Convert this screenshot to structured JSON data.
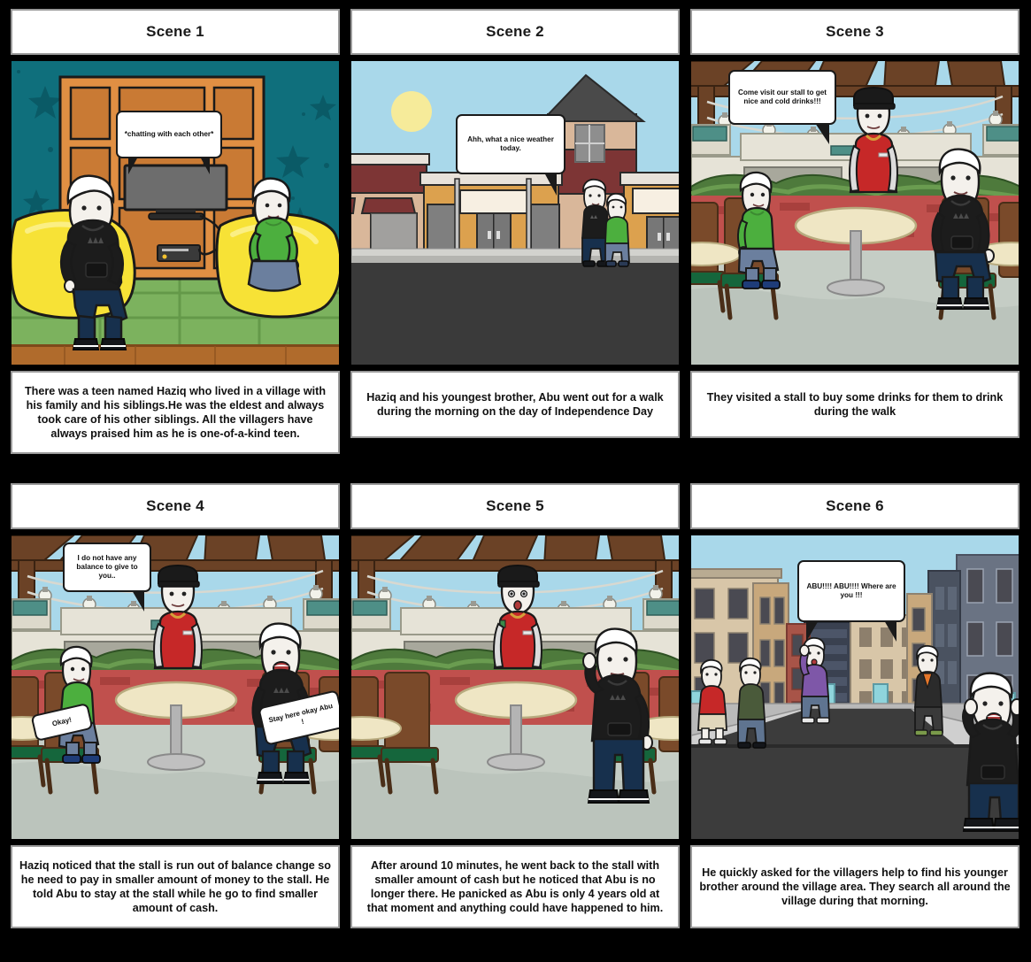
{
  "document": {
    "type": "storyboard",
    "title": "Haziq and Abu storyboard",
    "rows": 2,
    "columns": 3,
    "background_color": "#000000",
    "panel_border_color": "#9a9a9a"
  },
  "scenes": [
    {
      "id": "scene-1",
      "title": "Scene 1",
      "setting": "living-room",
      "caption": "There was a teen named Haziq who lived in a village with his family and his siblings.He was the eldest and always took care of his other siblings. All the villagers have always praised him as he is one-of-a-kind teen.",
      "bubbles": [
        {
          "text": "*chatting with each other*",
          "speaker": "narration",
          "tail": "both"
        }
      ],
      "colors": {
        "wall": "#0f6f7c",
        "shelf": "#e08f43",
        "shelf_inner": "#c97a34",
        "beanbag": "#f7e236",
        "rug": "#6aa84f",
        "floor": "#b06b2c",
        "tv_screen": "#7a7a7a"
      },
      "characters": [
        {
          "name": "Haziq",
          "shirt": "#1c1c1c",
          "pants": "#17304d",
          "pose": "sitting-beanbag-left"
        },
        {
          "name": "Abu",
          "shirt": "#4caf3e",
          "pants": "#6b7f9e",
          "pose": "kneeling-beanbag-right"
        }
      ]
    },
    {
      "id": "scene-2",
      "title": "Scene 2",
      "setting": "town-street",
      "caption": "Haziq and his youngest brother, Abu went out for a walk during the morning on the day of Independence Day",
      "bubbles": [
        {
          "text": "Ahh, what a nice weather today.",
          "speaker": "Haziq",
          "tail": "right"
        }
      ],
      "colors": {
        "sky": "#a9d8ea",
        "sun": "#f6eb9a",
        "road": "#3a3a3a",
        "sidewalk": "#c9c9c4",
        "building_tan": "#d9b79a",
        "building_orange": "#dca14e",
        "awning": "#7d3535",
        "roof": "#4a4a4a"
      },
      "characters": [
        {
          "name": "Haziq",
          "shirt": "#1c1c1c",
          "pants": "#17304d",
          "pose": "standing"
        },
        {
          "name": "Abu",
          "shirt": "#4caf3e",
          "pants": "#6b7f9e",
          "pose": "standing"
        }
      ]
    },
    {
      "id": "scene-3",
      "title": "Scene 3",
      "setting": "cafe-patio",
      "caption": "They visited a stall to buy some drinks for them to drink during the walk",
      "bubbles": [
        {
          "text": "Come visit our stall to get nice and cold drinks!!!",
          "speaker": "Stall vendor",
          "tail": "right"
        }
      ],
      "colors": {
        "sky": "#a9d8ea",
        "pergola": "#5b3a22",
        "brick_wall": "#c0504d",
        "hedge": "#4e7a3c",
        "ground": "#c5cdc5",
        "table": "#efe6c4",
        "chair_wood": "#7a4a2a",
        "chair_cushion": "#15663c",
        "vendor_shirt": "#c62828",
        "vendor_cap": "#1a1a1a"
      },
      "characters": [
        {
          "name": "Abu",
          "shirt": "#4caf3e",
          "pants": "#6b7f9e",
          "pose": "sitting-chair-left"
        },
        {
          "name": "Vendor",
          "shirt": "#c62828",
          "pants": "#d9d9d9",
          "pose": "standing-behind-counter"
        },
        {
          "name": "Haziq",
          "shirt": "#1c1c1c",
          "pants": "#17304d",
          "pose": "sitting-chair-right"
        }
      ]
    },
    {
      "id": "scene-4",
      "title": "Scene 4",
      "setting": "cafe-patio",
      "caption": "Haziq noticed that the stall is run out of balance change so he need to pay in smaller amount of money to the stall. He told Abu to stay at the stall while he go to find smaller amount of cash.",
      "bubbles": [
        {
          "text": "I do not have any balance to give to you..",
          "speaker": "Vendor",
          "tail": "right"
        },
        {
          "text": "Okay!",
          "speaker": "Abu",
          "tail": "none",
          "rotated": true
        },
        {
          "text": "Stay here okay Abu !",
          "speaker": "Haziq",
          "tail": "none",
          "rotated": true
        }
      ],
      "colors": {
        "sky": "#a9d8ea",
        "pergola": "#5b3a22",
        "brick_wall": "#c0504d",
        "hedge": "#4e7a3c",
        "ground": "#c5cdc5",
        "table": "#efe6c4",
        "chair_wood": "#7a4a2a",
        "chair_cushion": "#15663c",
        "vendor_shirt": "#c62828"
      },
      "characters": [
        {
          "name": "Abu",
          "shirt": "#4caf3e",
          "pants": "#6b7f9e",
          "pose": "sitting-chair-left"
        },
        {
          "name": "Vendor",
          "shirt": "#c62828",
          "pants": "#d9d9d9",
          "pose": "standing-behind-counter"
        },
        {
          "name": "Haziq",
          "shirt": "#1c1c1c",
          "pants": "#17304d",
          "pose": "sitting-chair-right"
        }
      ]
    },
    {
      "id": "scene-5",
      "title": "Scene 5",
      "setting": "cafe-patio",
      "caption": "After around 10 minutes, he went back to the stall with smaller amount of cash but he noticed that Abu is no longer there. He panicked as Abu is only 4 years old at that moment and anything could have happened to him.",
      "bubbles": [],
      "colors": {
        "sky": "#a9d8ea",
        "pergola": "#5b3a22",
        "brick_wall": "#c0504d",
        "hedge": "#4e7a3c",
        "ground": "#c5cdc5",
        "table": "#efe6c4",
        "chair_wood": "#7a4a2a",
        "chair_cushion": "#15663c",
        "vendor_shirt": "#c62828"
      },
      "characters": [
        {
          "name": "Vendor",
          "shirt": "#c62828",
          "pants": "#d9d9d9",
          "pose": "standing-shocked"
        },
        {
          "name": "Haziq",
          "shirt": "#1c1c1c",
          "pants": "#17304d",
          "pose": "standing-worried"
        }
      ]
    },
    {
      "id": "scene-6",
      "title": "Scene 6",
      "setting": "city-street",
      "caption": "He quickly asked for the villagers help to find his younger brother around the village area. They search all around the village during that morning.",
      "bubbles": [
        {
          "text": "ABU!!!! ABU!!!! Where are you !!!",
          "speaker": "Haziq",
          "tail": "both"
        }
      ],
      "colors": {
        "sky": "#a9d8ea",
        "road": "#3c3c3c",
        "sidewalk": "#b9b9b9",
        "building_beige": "#d8c6a8",
        "building_tan": "#c8a87c",
        "building_red": "#a85448",
        "building_blue": "#6a7383",
        "building_gray": "#3a4150",
        "window": "#4a4a52"
      },
      "characters": [
        {
          "name": "Villager 1",
          "shirt": "#c62828",
          "pants": "#e0d6bb",
          "pose": "standing"
        },
        {
          "name": "Villager 2",
          "shirt": "#4a5a3a",
          "pants": "#5f7490",
          "pose": "standing"
        },
        {
          "name": "Villager 3",
          "shirt": "#7e57a8",
          "pants": "#5f7490",
          "pose": "standing-waving"
        },
        {
          "name": "Villager 4",
          "shirt": "#2b2b2b",
          "pants": "#3a3a3a",
          "pose": "standing"
        },
        {
          "name": "Haziq",
          "shirt": "#1c1c1c",
          "pants": "#17304d",
          "pose": "standing-shouting"
        }
      ]
    }
  ]
}
